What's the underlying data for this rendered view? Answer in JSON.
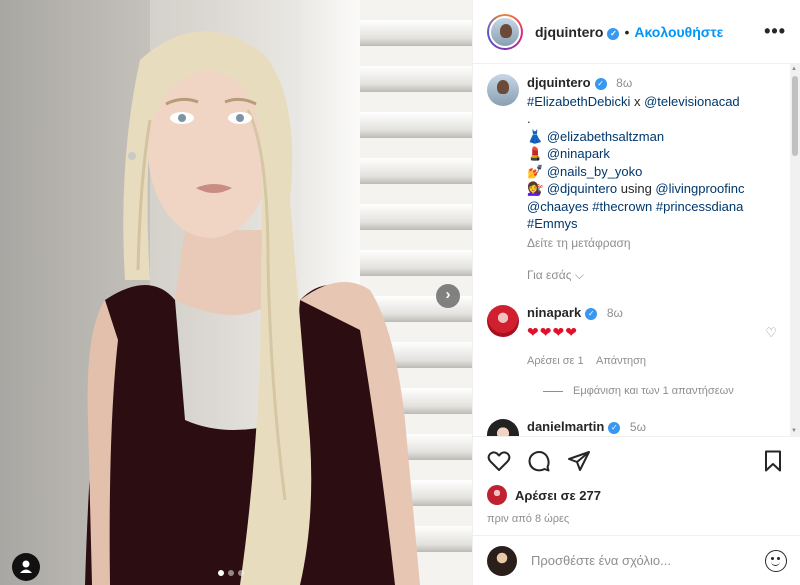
{
  "post": {
    "username": "djquintero",
    "dot": "•",
    "follow_label": "Ακολουθήστε",
    "more_label": "•••"
  },
  "photo": {
    "carousel_count": 3,
    "carousel_active": 1,
    "next_icon": "chevron-right-icon",
    "tagged_icon": "person-icon"
  },
  "caption": {
    "username": "djquintero",
    "time": "8ω",
    "line1_tag1": "#ElizabethDebicki",
    "line1_x": " x ",
    "line1_tag2": "@televisionacad",
    "dot_line": ".",
    "credits": [
      {
        "emoji": "👗",
        "text": "@elizabethsaltzman"
      },
      {
        "emoji": "💄",
        "text": "@ninapark"
      },
      {
        "emoji": "💅",
        "text": "@nails_by_yoko"
      },
      {
        "emoji": "💇‍♀️",
        "text": "@djquintero",
        "suffix": " using ",
        "extra": "@livingproofinc"
      }
    ],
    "last_line_tags": [
      "@chaayes",
      "#thecrown",
      "#princessdiana"
    ],
    "final_tag": "#Emmys",
    "translate": "Δείτε τη μετάφραση",
    "for_you": "Για εσάς ⌵"
  },
  "comments": [
    {
      "username": "ninapark",
      "time": "8ω",
      "text": "❤❤❤❤",
      "likes": "Αρέσει σε 1",
      "reply": "Απάντηση"
    },
    {
      "username": "danielmartin",
      "time": "5ω",
      "text": "❤❤❤"
    }
  ],
  "view_replies": "Εμφάνιση και των 1 απαντήσεων",
  "likes": "Αρέσει σε 277",
  "post_time": "πριν από 8 ώρες",
  "add_comment": {
    "placeholder": "Προσθέστε ένα σχόλιο..."
  },
  "colors": {
    "follow_blue": "#0095f6",
    "verified_blue": "#3897f0",
    "tag_link": "#00376b",
    "heart_red": "#e0102a"
  }
}
